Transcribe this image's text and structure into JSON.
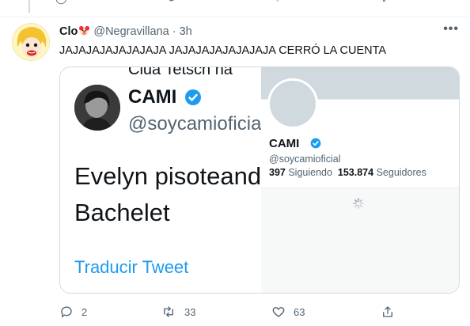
{
  "tweet": {
    "author_name": "Clo",
    "author_handle": "@Negravillana",
    "separator": "·",
    "time": "3h",
    "more": "•••",
    "text": "JAJAJAJAJAJAJAJA JAJAJAJAJAJAJAJA CERRÓ LA CUENTA"
  },
  "media": {
    "screenshot": {
      "cut_text": "Clua Tetsch na",
      "name": "CAMI",
      "handle": "@soycamioficia",
      "body_line1": "Evelyn pisoteand",
      "body_line2": "Bachelet",
      "translate": "Traducir Tweet"
    },
    "profile_card": {
      "name": "CAMI",
      "handle": "@soycamioficial",
      "following_count": "397",
      "following_label": "Siguiendo",
      "followers_count": "153.874",
      "followers_label": "Seguidores"
    }
  },
  "actions": {
    "replies": "2",
    "retweets": "33",
    "likes": "63"
  },
  "colors": {
    "accent": "#1d9bf0",
    "text": "#0f1419",
    "muted": "#536471",
    "border": "#cfd9de"
  }
}
